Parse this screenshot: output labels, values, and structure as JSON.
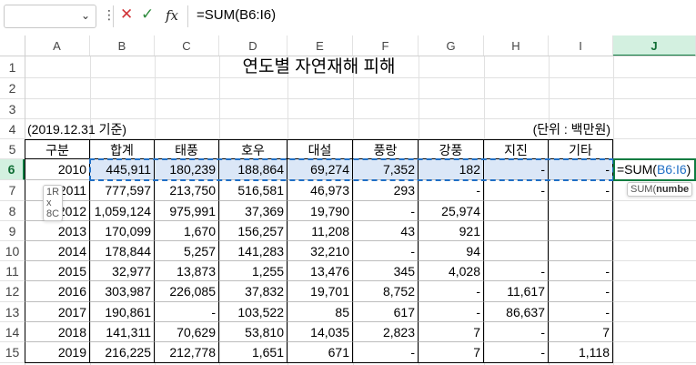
{
  "formula_bar": {
    "name_box_value": "",
    "formula": "=SUM(B6:I6)",
    "fx_label": "fx"
  },
  "columns": [
    "A",
    "B",
    "C",
    "D",
    "E",
    "F",
    "G",
    "H",
    "I",
    "J"
  ],
  "rows": [
    "1",
    "2",
    "3",
    "4",
    "5",
    "6",
    "7",
    "8",
    "9",
    "10",
    "11",
    "12",
    "13",
    "14",
    "15"
  ],
  "sheet": {
    "title": "연도별 자연재해 피해",
    "date_note": "(2019.12.31 기준)",
    "unit_note": "(단위 : 백만원)",
    "headers": [
      "구분",
      "합계",
      "태풍",
      "호우",
      "대설",
      "풍랑",
      "강풍",
      "지진",
      "기타"
    ],
    "data_rows": [
      [
        "2010",
        "445,911",
        "180,239",
        "188,864",
        "69,274",
        "7,352",
        "182",
        "-",
        "-"
      ],
      [
        "2011",
        "777,597",
        "213,750",
        "516,581",
        "46,973",
        "293",
        "-",
        "-",
        "-"
      ],
      [
        "2012",
        "1,059,124",
        "975,991",
        "37,369",
        "19,790",
        "-",
        "25,974",
        "",
        ""
      ],
      [
        "2013",
        "170,099",
        "1,670",
        "156,257",
        "11,208",
        "43",
        "921",
        "",
        ""
      ],
      [
        "2014",
        "178,844",
        "5,257",
        "141,283",
        "32,210",
        "-",
        "94",
        "",
        ""
      ],
      [
        "2015",
        "32,977",
        "13,873",
        "1,255",
        "13,476",
        "345",
        "4,028",
        "-",
        "-"
      ],
      [
        "2016",
        "303,987",
        "226,085",
        "37,832",
        "19,701",
        "8,752",
        "-",
        "11,617",
        "-"
      ],
      [
        "2017",
        "190,861",
        "-",
        "103,522",
        "85",
        "617",
        "-",
        "86,637",
        "-"
      ],
      [
        "2018",
        "141,311",
        "70,629",
        "53,810",
        "14,035",
        "2,823",
        "7",
        "-",
        "7"
      ],
      [
        "2019",
        "216,225",
        "212,778",
        "1,651",
        "671",
        "-",
        "7",
        "-",
        "1,118"
      ]
    ],
    "active_cell_formula_prefix": "=SUM(",
    "active_cell_formula_ref": "B6:I6",
    "active_cell_formula_suffix": ")",
    "selection_size_tip": "1R x 8C",
    "function_tip_prefix": "SUM(",
    "function_tip_arg": "numbe"
  },
  "colors": {
    "accent": "#107c41",
    "selection_fill": "#dbe7f7",
    "reference_blue": "#1f6fc5"
  }
}
